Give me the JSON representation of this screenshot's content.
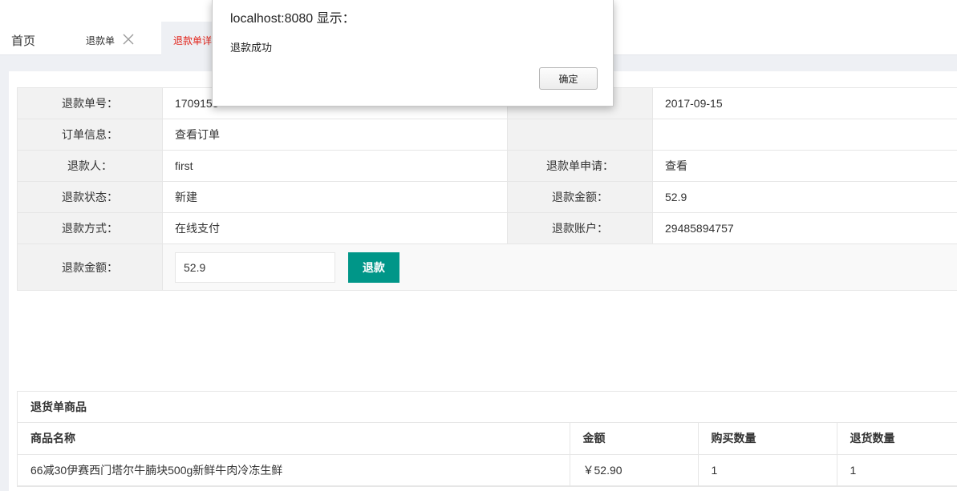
{
  "tabs": {
    "home": "首页",
    "refund_list": "退款单",
    "refund_detail": "退款单详"
  },
  "info": {
    "rows": [
      {
        "label1": "退款单号：",
        "value1": "1709153",
        "label2": "",
        "value2": "2017-09-15"
      },
      {
        "label1": "订单信息：",
        "value1": "查看订单",
        "label2": "",
        "value2": ""
      },
      {
        "label1": "退款人：",
        "value1": "first",
        "label2": "退款单申请：",
        "value2": "查看"
      },
      {
        "label1": "退款状态：",
        "value1": "新建",
        "label2": "退款金额：",
        "value2": "52.9"
      },
      {
        "label1": "退款方式：",
        "value1": "在线支付",
        "label2": "退款账户：",
        "value2": "29485894757"
      }
    ],
    "refund_amount_label": "退款金额：",
    "refund_amount_value": "52.9",
    "refund_button": "退款"
  },
  "goods": {
    "title": "退货单商品",
    "headers": [
      "商品名称",
      "金额",
      "购买数量",
      "退货数量"
    ],
    "rows": [
      [
        "66减30伊赛西门塔尔牛腩块500g新鲜牛肉冷冻生鲜",
        "￥52.90",
        "1",
        "1"
      ]
    ]
  },
  "dialog": {
    "title": "localhost:8080 显示：",
    "message": "退款成功",
    "ok": "确定"
  },
  "colors": {
    "accent": "#009688",
    "active_tab_text": "#e2231a"
  }
}
